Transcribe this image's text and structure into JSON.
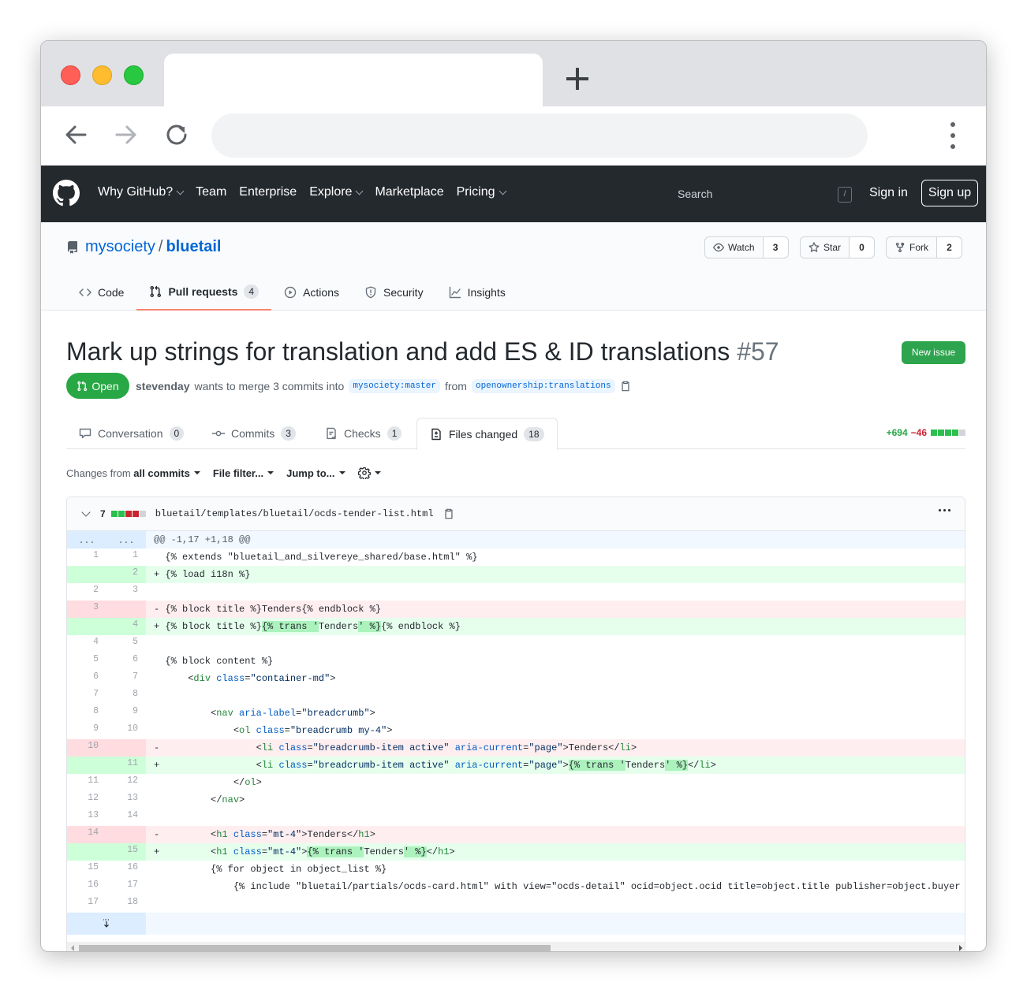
{
  "github_nav": {
    "items": [
      "Why GitHub?",
      "Team",
      "Enterprise",
      "Explore",
      "Marketplace",
      "Pricing"
    ],
    "search_placeholder": "Search",
    "search_key": "/",
    "signin": "Sign in",
    "signup": "Sign up"
  },
  "repo": {
    "owner": "mysociety",
    "separator": "/",
    "name": "bluetail",
    "watch_label": "Watch",
    "watch_count": "3",
    "star_label": "Star",
    "star_count": "0",
    "fork_label": "Fork",
    "fork_count": "2",
    "tabs": [
      {
        "label": "Code",
        "icon": "code-icon"
      },
      {
        "label": "Pull requests",
        "count": "4",
        "icon": "pull-request-icon"
      },
      {
        "label": "Actions",
        "icon": "play-icon"
      },
      {
        "label": "Security",
        "icon": "shield-icon"
      },
      {
        "label": "Insights",
        "icon": "graph-icon"
      }
    ]
  },
  "pr": {
    "title": "Mark up strings for translation and add ES & ID translations",
    "number": "#57",
    "new_issue": "New issue",
    "state": "Open",
    "author": "stevenday",
    "merge_text": "wants to merge 3 commits into",
    "base_branch": "mysociety:master",
    "from_text": "from",
    "head_branch": "openownership:translations",
    "tabs": [
      {
        "label": "Conversation",
        "count": "0"
      },
      {
        "label": "Commits",
        "count": "3"
      },
      {
        "label": "Checks",
        "count": "1"
      },
      {
        "label": "Files changed",
        "count": "18"
      }
    ],
    "additions": "+694",
    "deletions": "−46"
  },
  "filters": {
    "changes_prefix": "Changes from",
    "changes_value": "all commits",
    "file_filter": "File filter...",
    "jump_to": "Jump to..."
  },
  "file": {
    "changes": "7",
    "path": "bluetail/templates/bluetail/ocds-tender-list.html",
    "hunk_left": "...",
    "hunk_right": "...",
    "hunk": "@@ -1,17 +1,18 @@"
  },
  "colors": {
    "header_bg": "#24292e",
    "link": "#0366d6",
    "open_green": "#28a745",
    "add_bg": "#e6ffed",
    "del_bg": "#ffeef0",
    "active_tab_accent": "#f9826c"
  }
}
